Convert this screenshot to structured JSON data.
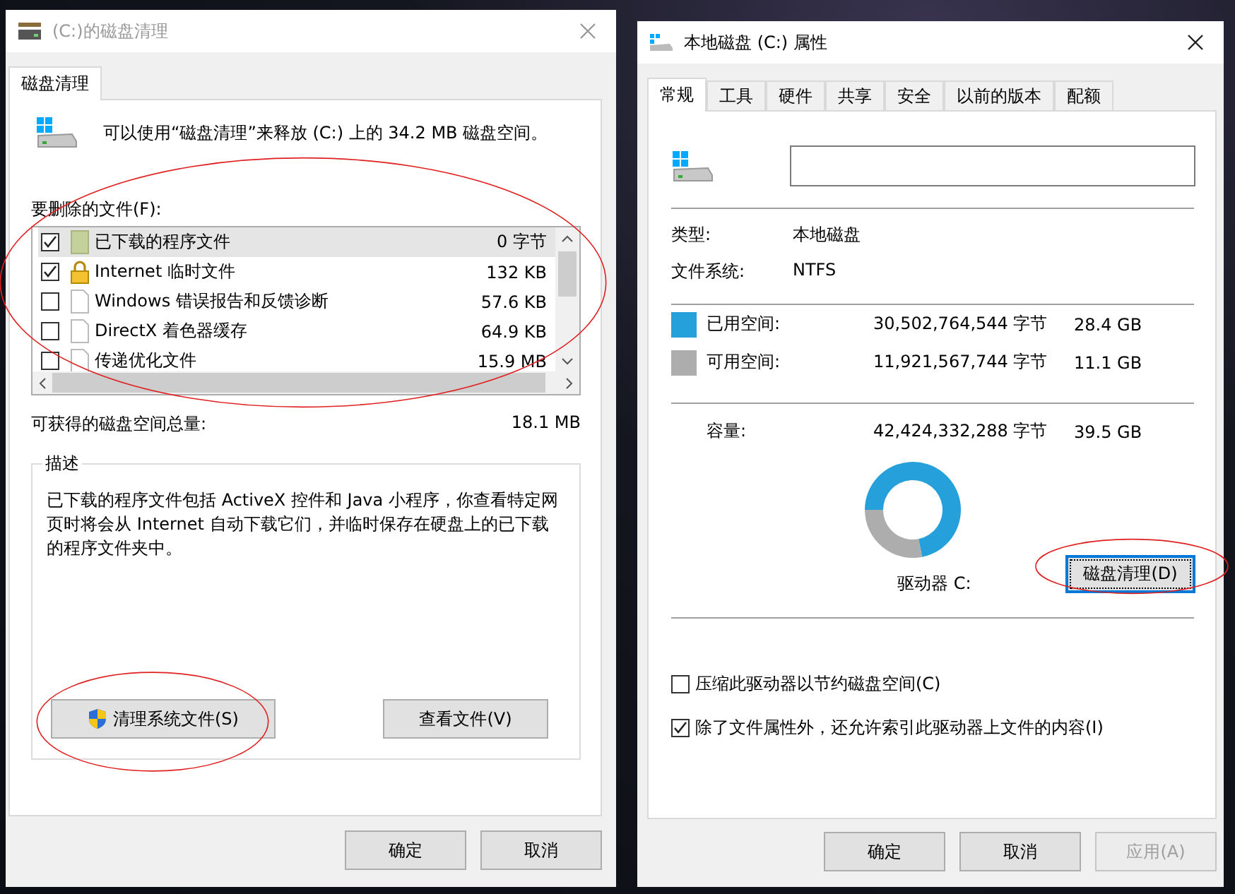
{
  "cleanup_window": {
    "title": "(C:)的磁盘清理",
    "active": false,
    "tabs": [
      {
        "label": "磁盘清理",
        "selected": true
      }
    ],
    "message": "可以使用“磁盘清理”来释放  (C:) 上的 34.2 MB 磁盘空间。",
    "files_label": "要删除的文件(F):",
    "files_circled": true,
    "files": [
      {
        "name": "已下载的程序文件",
        "size": "0 字节",
        "checked": true,
        "selected": true,
        "kind": "folder"
      },
      {
        "name": "Internet 临时文件",
        "size": "132 KB",
        "checked": true,
        "selected": false,
        "kind": "lock"
      },
      {
        "name": "Windows 错误报告和反馈诊断",
        "size": "57.6 KB",
        "checked": false,
        "selected": false,
        "kind": "file"
      },
      {
        "name": "DirectX 着色器缓存",
        "size": "64.9 KB",
        "checked": false,
        "selected": false,
        "kind": "file"
      },
      {
        "name": "传递优化文件",
        "size": "15.9 MB",
        "checked": false,
        "selected": false,
        "kind": "file"
      }
    ],
    "total_label": "可获得的磁盘空间总量:",
    "total": "18.1 MB",
    "description": {
      "title": "描述",
      "text": "已下载的程序文件包括 ActiveX 控件和 Java 小程序，你查看特定网页时将会从 Internet 自动下载它们，并临时保存在硬盘上的已下载的程序文件夹中。"
    },
    "clean_system_button": {
      "label": "清理系统文件(S)",
      "circled": true
    },
    "view_files_button": {
      "label": "查看文件(V)"
    },
    "buttons": [
      {
        "label": "确定",
        "disabled": false
      },
      {
        "label": "取消",
        "disabled": false
      }
    ]
  },
  "properties_window": {
    "title": "本地磁盘 (C:) 属性",
    "active": true,
    "tabs": [
      {
        "label": "常规",
        "selected": true
      },
      {
        "label": "工具",
        "selected": false
      },
      {
        "label": "硬件",
        "selected": false
      },
      {
        "label": "共享",
        "selected": false
      },
      {
        "label": "安全",
        "selected": false
      },
      {
        "label": "以前的版本",
        "selected": false
      },
      {
        "label": "配额",
        "selected": false
      }
    ],
    "type_label": "类型:",
    "type": "本地磁盘",
    "fs_label": "文件系统:",
    "fs": "NTFS",
    "space": [
      {
        "label": "已用空间:",
        "bytes": "30,502,764,544 字节",
        "size": "28.4 GB",
        "color": "#26a0da"
      },
      {
        "label": "可用空间:",
        "bytes": "11,921,567,744 字节",
        "size": "11.1 GB",
        "color": "#adadad"
      }
    ],
    "capacity": {
      "label": "容量:",
      "bytes": "42,424,332,288 字节",
      "size": "39.5 GB"
    },
    "chart_data": {
      "type": "donut",
      "values": [
        71.9,
        28.1
      ]
    },
    "drive_label": "驱动器 C:",
    "cleanup_button": {
      "label": "磁盘清理(D)",
      "circled": true,
      "focused": true
    },
    "options": [
      {
        "label": "压缩此驱动器以节约磁盘空间(C)",
        "checked": false
      },
      {
        "label": "除了文件属性外，还允许索引此驱动器上文件的内容(I)",
        "checked": true
      }
    ],
    "buttons": [
      {
        "label": "确定",
        "disabled": false
      },
      {
        "label": "取消",
        "disabled": false
      },
      {
        "label": "应用(A)",
        "disabled": true
      }
    ]
  }
}
